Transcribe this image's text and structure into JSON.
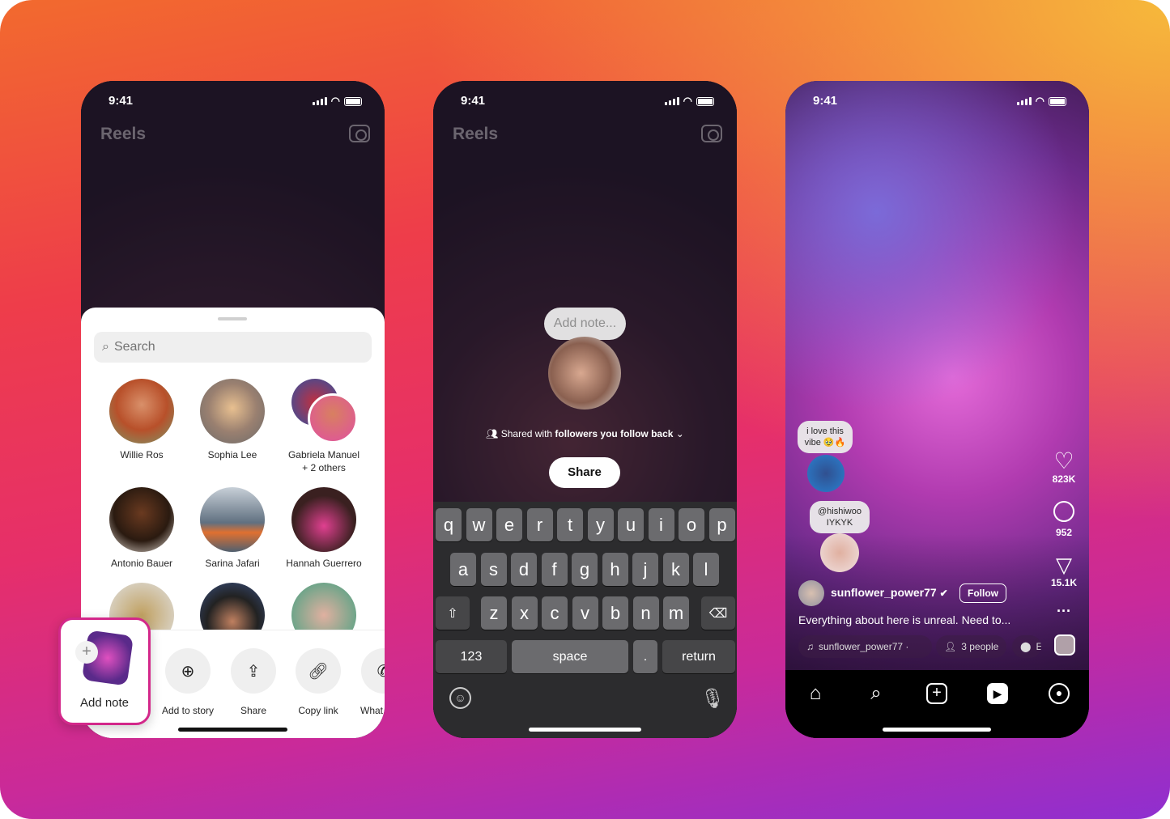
{
  "colors": {
    "accent": "#d3288a",
    "follow_border": "#ffffff",
    "sheet": "#ffffff",
    "keyboard": "#2c2c2e"
  },
  "status": {
    "time": "9:41"
  },
  "phone1": {
    "header_title": "Reels",
    "search_placeholder": "Search",
    "contacts": [
      {
        "name": "Willie Ros",
        "sub": ""
      },
      {
        "name": "Sophia Lee",
        "sub": ""
      },
      {
        "name": "Gabriela Manuel",
        "sub": "+ 2 others"
      },
      {
        "name": "Antonio Bauer",
        "sub": ""
      },
      {
        "name": "Sarina Jafari",
        "sub": ""
      },
      {
        "name": "Hannah Guerrero",
        "sub": ""
      }
    ],
    "add_note": "Add note",
    "actions": [
      {
        "label": "Add to story",
        "icon": "add-story-icon"
      },
      {
        "label": "Share",
        "icon": "share-icon"
      },
      {
        "label": "Copy link",
        "icon": "link-icon"
      },
      {
        "label": "What",
        "icon": "whatsapp-icon"
      }
    ]
  },
  "phone2": {
    "header_title": "Reels",
    "note_placeholder": "Add note...",
    "shared_prefix": "Shared with ",
    "shared_audience": "followers you follow back",
    "share_button": "Share",
    "keyboard": {
      "row1": [
        "q",
        "w",
        "e",
        "r",
        "t",
        "y",
        "u",
        "i",
        "o",
        "p"
      ],
      "row2": [
        "a",
        "s",
        "d",
        "f",
        "g",
        "h",
        "j",
        "k",
        "l"
      ],
      "row3": [
        "z",
        "x",
        "c",
        "v",
        "b",
        "n",
        "m"
      ],
      "numbers": "123",
      "space": "space",
      "period": ".",
      "return": "return"
    }
  },
  "phone3": {
    "notes": [
      {
        "text": "i love this vibe 🥹🔥"
      },
      {
        "text": "@hishiwoo IYKYK"
      }
    ],
    "likes": "823K",
    "comments": "952",
    "shares": "15.1K",
    "username": "sunflower_power77",
    "verified": true,
    "follow": "Follow",
    "caption": "Everything about here is unreal. Need to...",
    "chips": {
      "audio": "sunflower_power77 · ",
      "people": "3 people",
      "location": "E"
    },
    "nav": [
      "home-icon",
      "search-icon",
      "create-icon",
      "reels-icon",
      "profile-icon"
    ]
  }
}
